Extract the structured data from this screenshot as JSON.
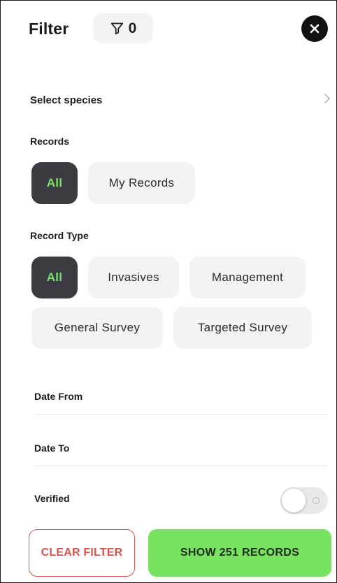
{
  "header": {
    "title": "Filter",
    "filter_count": "0",
    "filter_icon": "funnel-icon",
    "close_icon": "close-icon"
  },
  "species": {
    "label": "Select species",
    "icon": "chevron-right-icon"
  },
  "records": {
    "label": "Records",
    "options": [
      "All",
      "My Records"
    ],
    "selected": "All"
  },
  "record_type": {
    "label": "Record Type",
    "options": [
      "All",
      "Invasives",
      "Management",
      "General Survey",
      "Targeted Survey"
    ],
    "selected": "All"
  },
  "dates": {
    "from_label": "Date From",
    "to_label": "Date To"
  },
  "verified": {
    "label": "Verified",
    "on": false
  },
  "actions": {
    "clear_label": "CLEAR FILTER",
    "show_label": "SHOW 251 RECORDS"
  },
  "colors": {
    "accent_green": "#78e35e",
    "active_chip_bg": "#3a3c41",
    "active_chip_text": "#7ee36a",
    "danger_red": "#d9534f",
    "chip_bg": "#f2f3f5"
  }
}
